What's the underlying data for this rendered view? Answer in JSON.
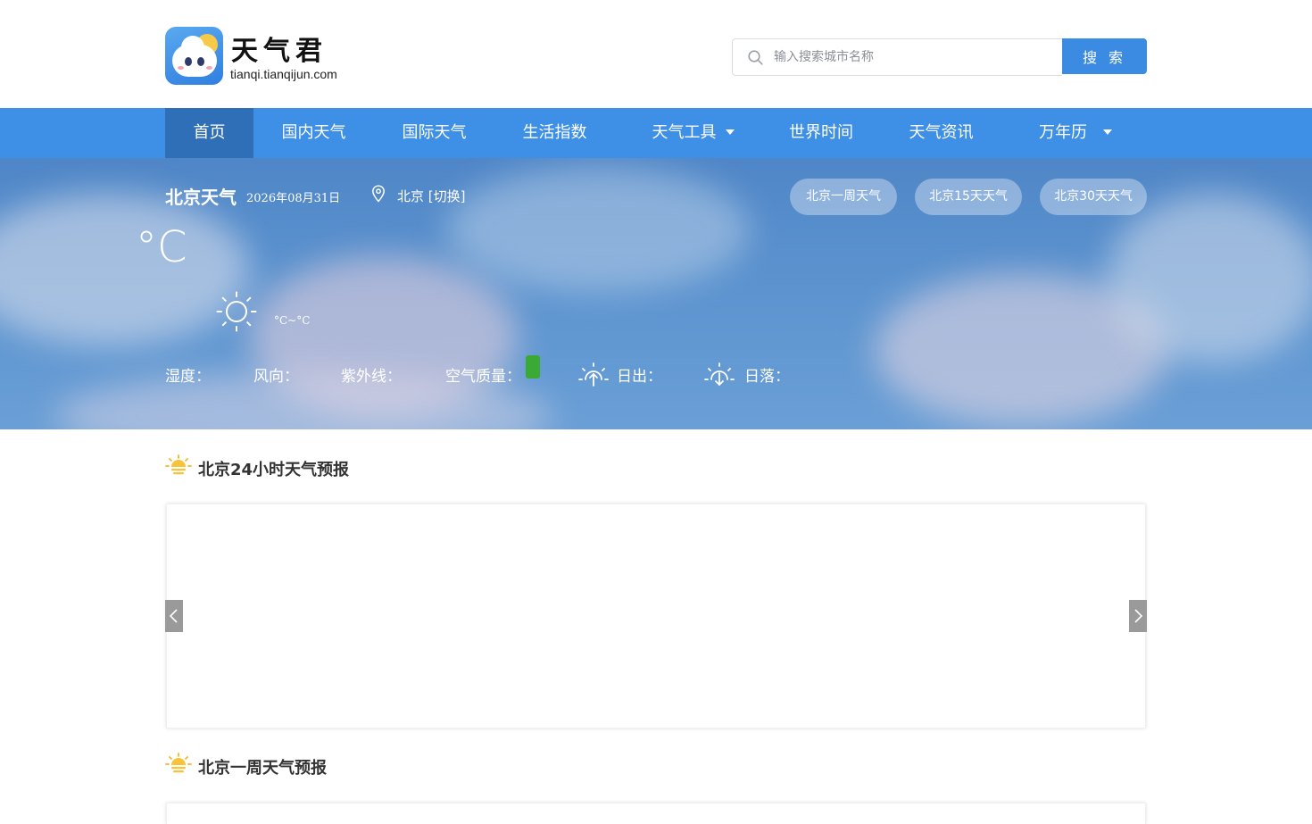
{
  "brand": {
    "name": "天气君",
    "url": "tianqi.tianqijun.com"
  },
  "search": {
    "placeholder": "输入搜索城市名称",
    "button_label": "搜 索"
  },
  "nav": {
    "items": [
      {
        "label": "首页"
      },
      {
        "label": "国内天气"
      },
      {
        "label": "国际天气"
      },
      {
        "label": "生活指数"
      },
      {
        "label": "天气工具"
      },
      {
        "label": "世界时间"
      },
      {
        "label": "天气资讯"
      },
      {
        "label": "万年历"
      }
    ]
  },
  "hero": {
    "title": "北京天气",
    "date": "2026年08月31日",
    "location": "北京 [切换]",
    "pills": [
      "北京一周天气",
      "北京15天天气",
      "北京30天天气"
    ],
    "temp_unit": "°C",
    "temp_range": "°C~°C",
    "stats": {
      "humidity": "湿度：",
      "wind": "风向：",
      "uv": "紫外线：",
      "air": "空气质量：",
      "sunrise": "日出：",
      "sunset": "日落："
    },
    "air_quality_color": "#3aaa35"
  },
  "sections": {
    "hourly_title": "北京24小时天气预报",
    "weekly_title": "北京一周天气预报"
  },
  "colors": {
    "nav": "#3e8fe6",
    "nav_active": "#2f6fb8",
    "accent": "#3b8be2"
  }
}
